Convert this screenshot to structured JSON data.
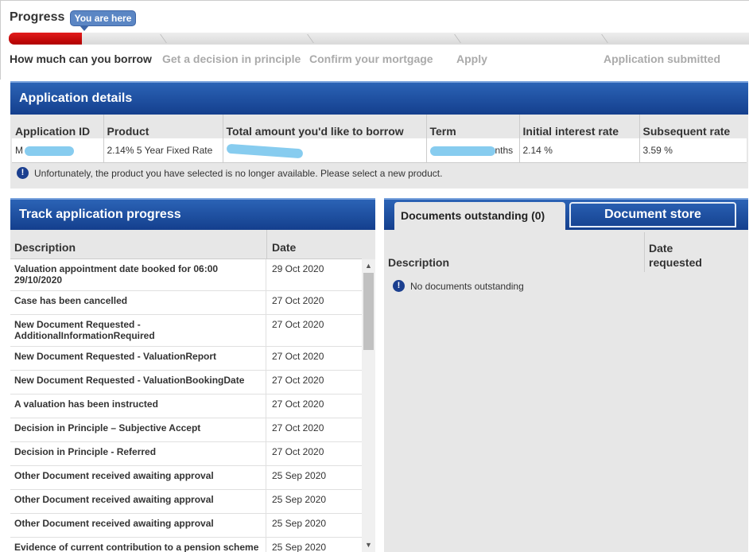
{
  "progress": {
    "title": "Progress",
    "badge": "You are here",
    "steps": [
      {
        "label": "How much can you borrow"
      },
      {
        "label": "Get a decision in principle"
      },
      {
        "label": "Confirm your mortgage"
      },
      {
        "label": "Apply"
      },
      {
        "label": "Application submitted"
      }
    ]
  },
  "app_details": {
    "title": "Application details",
    "columns": [
      "Application ID",
      "Product",
      "Total amount you'd like to borrow",
      "Term",
      "Initial interest rate",
      "Subsequent rate"
    ],
    "row": {
      "app_id_prefix": "M",
      "product": "2.14% 5 Year Fixed Rate",
      "amount": "",
      "term_suffix": "nths",
      "initial_rate": "2.14 %",
      "subsequent_rate": "3.59 %"
    },
    "notice": "Unfortunately, the product you have selected is no longer available. Please select a new product."
  },
  "track": {
    "title": "Track application progress",
    "col_description": "Description",
    "col_date": "Date",
    "rows": [
      {
        "description": "Valuation appointment date booked for 06:00 29/10/2020",
        "date": "29 Oct 2020"
      },
      {
        "description": "Case has been cancelled",
        "date": "27 Oct 2020"
      },
      {
        "description": "New Document Requested - AdditionalInformationRequired",
        "date": "27 Oct 2020"
      },
      {
        "description": "New Document Requested - ValuationReport",
        "date": "27 Oct 2020"
      },
      {
        "description": "New Document Requested - ValuationBookingDate",
        "date": "27 Oct 2020"
      },
      {
        "description": "A valuation has been instructed",
        "date": "27 Oct 2020"
      },
      {
        "description": "Decision in Principle – Subjective Accept",
        "date": "27 Oct 2020"
      },
      {
        "description": "Decision in Principle - Referred",
        "date": "27 Oct 2020"
      },
      {
        "description": "Other Document received awaiting approval",
        "date": "25 Sep 2020"
      },
      {
        "description": "Other Document received awaiting approval",
        "date": "25 Sep 2020"
      },
      {
        "description": "Other Document received awaiting approval",
        "date": "25 Sep 2020"
      },
      {
        "description": "Evidence of current contribution to a pension scheme",
        "date": "25 Sep 2020"
      }
    ]
  },
  "documents": {
    "tab_outstanding": "Documents outstanding (0)",
    "tab_store": "Document store",
    "col_description": "Description",
    "col_date": "Date requested",
    "empty": "No documents outstanding"
  },
  "icons": {
    "info": "info-icon",
    "scroll_up": "chevron-up-icon",
    "scroll_down": "chevron-down-icon"
  },
  "colors": {
    "accent_blue": "#1b4f9f",
    "progress_red": "#cc0000",
    "redaction": "#87ccef"
  }
}
